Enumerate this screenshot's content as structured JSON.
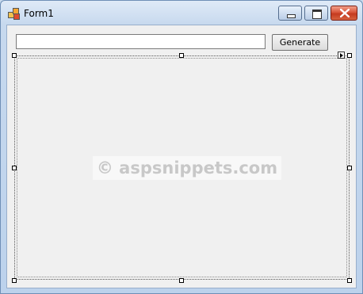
{
  "window": {
    "title": "Form1",
    "icon": "form-app-icon",
    "controls": {
      "minimize": "minimize-icon",
      "maximize": "maximize-icon",
      "close": "close-icon"
    }
  },
  "form": {
    "textbox_value": "",
    "generate_label": "Generate"
  },
  "designer": {
    "smart_tag_icon": "smart-tag-arrow-icon"
  },
  "watermark": {
    "text": "© aspsnippets.com"
  }
}
